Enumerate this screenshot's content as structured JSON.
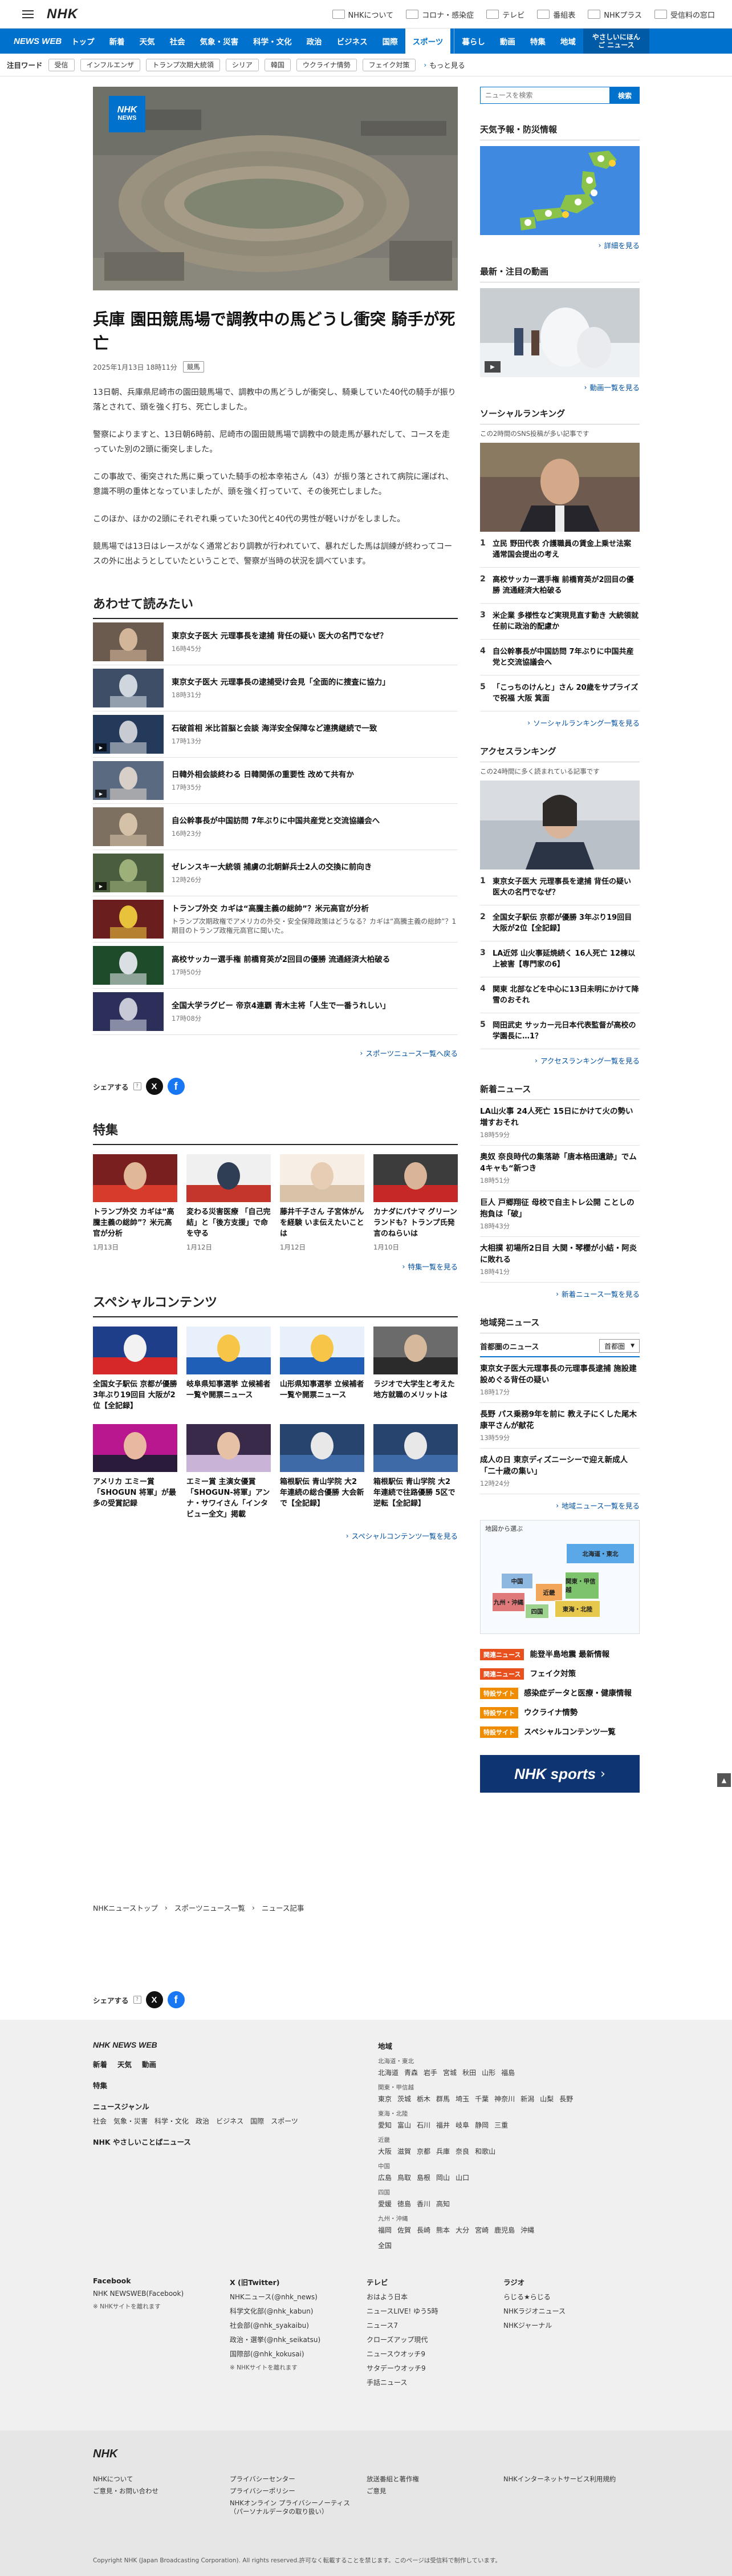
{
  "header": {
    "logo": "NHK",
    "links": [
      {
        "icon": "nhk-icon",
        "label": "NHKについて"
      },
      {
        "icon": "corona-icon",
        "label": "コロナ・感染症"
      },
      {
        "icon": "tv-icon",
        "label": "テレビ"
      },
      {
        "icon": "radio-icon",
        "label": "番組表"
      },
      {
        "icon": "nhkplus-icon",
        "label": "NHKプラス"
      },
      {
        "icon": "mail-icon",
        "label": "受信料の窓口"
      }
    ]
  },
  "nav": {
    "logo": "NEWS WEB",
    "items": [
      "トップ",
      "新着",
      "天気",
      "社会",
      "気象・災害",
      "科学・文化",
      "政治",
      "ビジネス",
      "国際",
      "スポーツ",
      "暮らし",
      "動画",
      "特集",
      "地域"
    ],
    "easy": "やさしいにほんご ニュース"
  },
  "hotwords": {
    "title": "注目ワード",
    "items": [
      "受信",
      "インフルエンザ",
      "トランプ次期大統領",
      "シリア",
      "韓国",
      "ウクライナ情勢",
      "フェイク対策"
    ],
    "more": "もっと見る"
  },
  "article": {
    "title": "兵庫 園田競馬場で調教中の馬どうし衝突 騎手が死亡",
    "date": "2025年1月13日 18時11分",
    "tag": "競馬",
    "hero_badge_1": "NHK",
    "hero_badge_2": "NEWS",
    "paragraphs": [
      "13日朝、兵庫県尼崎市の園田競馬場で、調教中の馬どうしが衝突し、騎乗していた40代の騎手が振り落とされて、頭を強く打ち、死亡しました。",
      "警察によりますと、13日朝6時前、尼崎市の園田競馬場で調教中の競走馬が暴れだして、コースを走っていた別の2頭に衝突しました。",
      "この事故で、衝突された馬に乗っていた騎手の松本幸祐さん（43）が振り落とされて病院に運ばれ、意識不明の重体となっていましたが、頭を強く打っていて、その後死亡しました。",
      "このほか、ほかの2頭にそれぞれ乗っていた30代と40代の男性が軽いけがをしました。",
      "競馬場では13日はレースがなく通常どおり調教が行われていて、暴れだした馬は訓練が終わってコースの外に出ようとしていたということで、警察が当時の状況を調べています。"
    ]
  },
  "related": {
    "title": "あわせて読みたい",
    "items": [
      {
        "title": "東京女子医大 元理事長を逮捕 背任の疑い 医大の名門でなぜ？",
        "sub": "",
        "time": "16時45分",
        "play": false
      },
      {
        "title": "東京女子医大 元理事長の逮捕受け会見「全面的に捜査に協力」",
        "sub": "",
        "time": "18時31分",
        "play": false
      },
      {
        "title": "石破首相 米比首脳と会談 海洋安全保障など連携継続で一致",
        "sub": "",
        "time": "17時13分",
        "play": true
      },
      {
        "title": "日韓外相会談終わる 日韓関係の重要性 改めて共有か",
        "sub": "",
        "time": "17時35分",
        "play": true
      },
      {
        "title": "自公幹事長が中国訪問 7年ぶりに中国共産党と交流協議会へ",
        "sub": "",
        "time": "16時23分",
        "play": false
      },
      {
        "title": "ゼレンスキー大統領 捕虜の北朝鮮兵士2人の交換に前向き",
        "sub": "",
        "time": "12時26分",
        "play": true
      },
      {
        "title": "トランプ外交 カギは“高騰主義の総帥”？米元高官が分析",
        "sub": "トランプ次期政権でアメリカの外交・安全保障政策はどうなる？カギは“高騰主義の総帥”？1期目のトランプ政権元高官に聞いた。",
        "time": "",
        "play": false
      },
      {
        "title": "高校サッカー選手権 前橋育英が2回目の優勝 流通経済大柏破る",
        "sub": "",
        "time": "17時50分",
        "play": false
      },
      {
        "title": "全国大学ラグビー 帝京4連覇 青木主将「人生で一番うれしい」",
        "sub": "",
        "time": "17時08分",
        "play": false
      }
    ],
    "more": "スポーツニュース一覧へ戻る"
  },
  "share": {
    "label": "シェアする",
    "help": "?"
  },
  "features": {
    "title": "特集",
    "items": [
      {
        "title": "トランプ外交 カギは“高騰主義の総帥”？米元高官が分析",
        "date": "1月13日"
      },
      {
        "title": "変わる災害医療 「自己完結」と「後方支援」で命を守る",
        "date": "1月12日"
      },
      {
        "title": "藤井千子さん 子宮体がんを経験 いま伝えたいことは",
        "date": "1月12日"
      },
      {
        "title": "カナダにパナマ グリーンランドも？トランプ氏発言のねらいは",
        "date": "1月10日"
      }
    ],
    "more": "特集一覧を見る"
  },
  "special": {
    "title": "スペシャルコンテンツ",
    "items": [
      {
        "title": "全国女子駅伝 京都が優勝 3年ぶり19回目 大阪が2位【全記録】"
      },
      {
        "title": "岐阜県知事選挙 立候補者一覧や開票ニュース"
      },
      {
        "title": "山形県知事選挙 立候補者一覧や開票ニュース"
      },
      {
        "title": "ラジオで大学生と考えた 地方就職のメリットは"
      },
      {
        "title": "アメリカ エミー賞「SHOGUN 将軍」が最多の受賞記録"
      },
      {
        "title": "エミー賞 主演女優賞「SHOGUN-将軍」アンナ・サワイさん「インタビュー全文」掲載"
      },
      {
        "title": "箱根駅伝 青山学院 大2年連続の総合優勝 大会新で【全記録】"
      },
      {
        "title": "箱根駅伝 青山学院 大2年連続で往路優勝 5区で逆転【全記録】"
      }
    ],
    "more": "スペシャルコンテンツ一覧を見る"
  },
  "side": {
    "search_placeholder": "ニュースを検索",
    "search_button": "検索",
    "weather": {
      "title": "天気予報・防災情報",
      "more": "詳細を見る"
    },
    "video": {
      "title": "最新・注目の動画",
      "more": "動画一覧を見る"
    },
    "social": {
      "title": "ソーシャルランキング",
      "sub": "この2時間のSNS投稿が多い記事です",
      "items": [
        "立民 野田代表 介護職員の賃金上乗せ法案 通常国会提出の考え",
        "高校サッカー選手権 前橋育英が2回目の優勝 流通経済大柏破る",
        "米企業 多様性など実現見直す動き 大統領就任前に政治的配慮か",
        "自公幹事長が中国訪問 7年ぶりに中国共産党と交流協議会へ",
        "「こっちのけんと」さん 20歳をサプライズで祝福 大阪 箕面"
      ],
      "more": "ソーシャルランキング一覧を見る"
    },
    "access": {
      "title": "アクセスランキング",
      "sub": "この24時間に多く読まれている記事です",
      "items": [
        "東京女子医大 元理事長を逮捕 背任の疑い 医大の名門でなぜ？",
        "全国女子駅伝 京都が優勝 3年ぶり19回目 大阪が2位【全記録】",
        "LA近郊 山火事延焼続く 16人死亡 12棟以上被害【専門家の6】",
        "関東 北部などを中心に13日未明にかけて降雪のおそれ",
        "岡田武史 サッカー元日本代表監督が高校の学園長に…1？"
      ],
      "more": "アクセスランキング一覧を見る"
    },
    "newest": {
      "title": "新着ニュース",
      "items": [
        {
          "title": "LA山火事 24人死亡 15日にかけて火の勢い増すおそれ",
          "time": "18時59分"
        },
        {
          "title": "奥奴 奈良時代の集落跡「唐本格田遺跡」でム4キャも“新つき",
          "time": "18時51分"
        },
        {
          "title": "巨人 戸郷翔征 母校で自主トレ公開 ことしの抱負は「破」",
          "time": "18時43分"
        },
        {
          "title": "大相撲 初場所2日目 大関・琴櫻が小結・阿炎に敗れる",
          "time": "18時41分"
        }
      ],
      "more": "新着ニュース一覧を見る"
    },
    "region": {
      "title": "地域発ニュース",
      "tab": "首都圏のニュース",
      "select": "首都圏",
      "items": [
        {
          "title": "東京女子医大元理事長の元理事長逮捕 施設建設めぐる背任の疑い",
          "time": "18時17分"
        },
        {
          "title": "長野 パス乗務9年を前に 教え子にくした尾木康平さんが献花",
          "time": "13時59分"
        },
        {
          "title": "成人の日 東京ディズニーシーで迎え新成人「二十歳の集い」",
          "time": "12時24分"
        }
      ],
      "more": "地域ニュース一覧を見る",
      "map_label": "地図から選ぶ",
      "map_areas": [
        "北海道・東北",
        "関東・甲信越",
        "近畿",
        "中国",
        "九州・沖縄",
        "四国",
        "東海・北陸"
      ]
    },
    "specials": [
      {
        "tag": "関連ニュース",
        "color": "#e8501e",
        "text": "能登半島地震 最新情報"
      },
      {
        "tag": "関連ニュース",
        "color": "#e8501e",
        "text": "フェイク対策"
      },
      {
        "tag": "特設サイト",
        "color": "#f08c00",
        "text": "感染症データと医療・健康情報"
      },
      {
        "tag": "特設サイト",
        "color": "#f08c00",
        "text": "ウクライナ情勢"
      },
      {
        "tag": "特設サイト",
        "color": "#f08c00",
        "text": "スペシャルコンテンツ一覧"
      }
    ],
    "banner": "NHK sports"
  },
  "breadcrumb": [
    "NHKニューストップ",
    "スポーツニュース一覧",
    "ニュース記事"
  ],
  "footer": {
    "brand": "NHK NEWS WEB",
    "left_links": [
      "新着",
      "天気",
      "動画"
    ],
    "feature": "特集",
    "genre_title": "ニュースジャンル",
    "genres": [
      "社会",
      "気象・災害",
      "科学・文化",
      "政治",
      "ビジネス",
      "国際",
      "スポーツ"
    ],
    "easy": "NHK やさしいことばニュース",
    "region_title": "地域",
    "regions": [
      {
        "area": "北海道・東北",
        "prefs": [
          "北海道",
          "青森",
          "岩手",
          "宮城",
          "秋田",
          "山形",
          "福島"
        ]
      },
      {
        "area": "関東・甲信越",
        "prefs": [
          "東京",
          "茨城",
          "栃木",
          "群馬",
          "埼玉",
          "千葉",
          "神奈川",
          "新潟",
          "山梨",
          "長野"
        ]
      },
      {
        "area": "東海・北陸",
        "prefs": [
          "愛知",
          "富山",
          "石川",
          "福井",
          "岐阜",
          "静岡",
          "三重"
        ]
      },
      {
        "area": "近畿",
        "prefs": [
          "大阪",
          "滋賀",
          "京都",
          "兵庫",
          "奈良",
          "和歌山"
        ]
      },
      {
        "area": "中国",
        "prefs": [
          "広島",
          "鳥取",
          "島根",
          "岡山",
          "山口"
        ]
      },
      {
        "area": "四国",
        "prefs": [
          "愛媛",
          "徳島",
          "香川",
          "高知"
        ]
      },
      {
        "area": "九州・沖縄",
        "prefs": [
          "福岡",
          "佐賀",
          "長崎",
          "熊本",
          "大分",
          "宮崎",
          "鹿児島",
          "沖縄"
        ]
      }
    ],
    "all": "全国",
    "sns": [
      {
        "title": "Facebook",
        "items": [
          "NHK NEWSWEB(Facebook)"
        ],
        "note": "※ NHKサイトを離れます"
      },
      {
        "title": "X (旧Twitter)",
        "items": [
          "NHKニュース(@nhk_news)",
          "科学文化部(@nhk_kabun)",
          "社会部(@nhk_syakaibu)",
          "政治・選挙(@nhk_seikatsu)",
          "国際部(@nhk_kokusai)"
        ],
        "note": "※ NHKサイトを離れます"
      },
      {
        "title": "テレビ",
        "items": [
          "おはよう日本",
          "ニュースLIVE! ゆう5時",
          "ニュース7",
          "クローズアップ現代",
          "ニュースウオッチ9",
          "サタデーウオッチ9",
          "手話ニュース"
        ],
        "note": ""
      },
      {
        "title": "ラジオ",
        "items": [
          "らじる★らじる",
          "NHKラジオニュース",
          "NHKジャーナル"
        ],
        "note": ""
      }
    ],
    "bottom_logo": "NHK",
    "bottom_links": [
      [
        "NHKについて",
        "ご意見・お問い合わせ"
      ],
      [
        "プライバシーセンター",
        "プライバシーポリシー",
        "NHKオンライン プライバシーノーティス（パーソナルデータの取り扱い）"
      ],
      [
        "放送番組と著作権",
        "ご意見"
      ],
      [
        "NHKインターネットサービス利用規約"
      ]
    ],
    "copyright": "Copyright NHK (Japan Broadcasting Corporation). All rights reserved.許可なく転載することを禁じます。このページは受信料で制作しています。"
  }
}
